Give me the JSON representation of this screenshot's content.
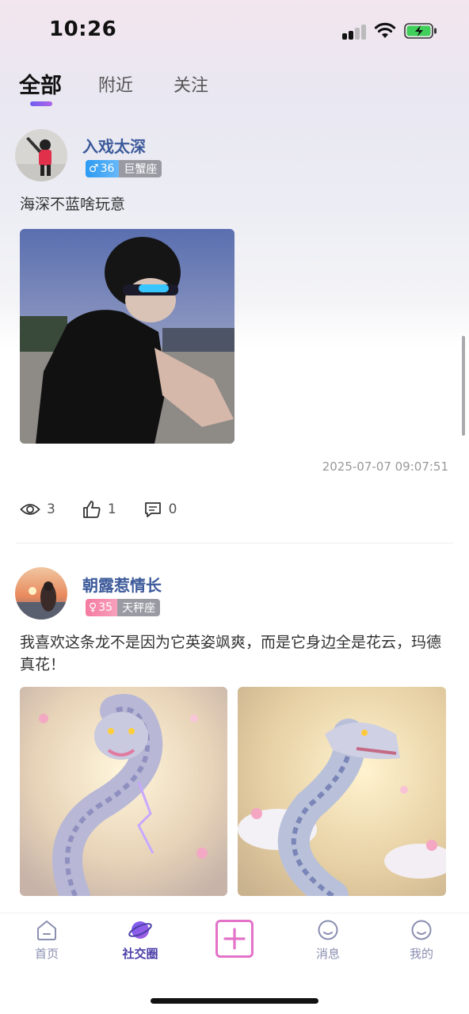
{
  "status_bar": {
    "time": "10:26"
  },
  "tabs": [
    {
      "label": "全部",
      "active": true
    },
    {
      "label": "附近",
      "active": false
    },
    {
      "label": "关注",
      "active": false
    }
  ],
  "posts": [
    {
      "username": "入戏太深",
      "gender": "male",
      "gender_symbol": "♂",
      "age": "36",
      "zodiac": "巨蟹座",
      "text": "海深不蓝啥玩意",
      "timestamp": "2025-07-07 09:07:51",
      "views": "3",
      "likes": "1",
      "comments": "0"
    },
    {
      "username": "朝露惹情长",
      "gender": "female",
      "gender_symbol": "♀",
      "age": "35",
      "zodiac": "天秤座",
      "text": "我喜欢这条龙不是因为它英姿飒爽，而是它身边全是花云，玛德真花！"
    }
  ],
  "bottom_nav": [
    {
      "label": "首页",
      "icon": "home-icon",
      "active": false
    },
    {
      "label": "社交圈",
      "icon": "planet-icon",
      "active": true
    },
    {
      "label": "",
      "icon": "add-icon",
      "active": false
    },
    {
      "label": "消息",
      "icon": "message-icon",
      "active": false
    },
    {
      "label": "我的",
      "icon": "profile-icon",
      "active": false
    }
  ],
  "colors": {
    "accent": "#4b3fa8",
    "username": "#3c5a9a",
    "male_tag": "#2b9bf3",
    "female_tag": "#f57aa0",
    "add_button": "#e373c8"
  }
}
